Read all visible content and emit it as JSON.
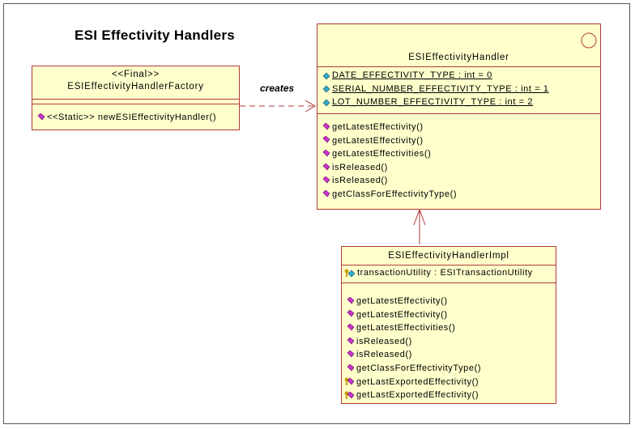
{
  "diagram": {
    "title": "ESI Effectivity Handlers",
    "factory": {
      "stereotype": "<<Final>>",
      "name": "ESIEffectivityHandlerFactory",
      "operations": [
        {
          "text": "<<Static>> newESIEffectivityHandler()",
          "icon": "public-operation-icon"
        }
      ]
    },
    "relation_label": "creates",
    "handler": {
      "name": "ESIEffectivityHandler",
      "attributes": [
        {
          "text": "DATE_EFFECTIVITY_TYPE : int = 0",
          "icon": "public-static-attribute-icon"
        },
        {
          "text": "SERIAL_NUMBER_EFFECTIVITY_TYPE : int = 1",
          "icon": "public-static-attribute-icon"
        },
        {
          "text": "LOT_NUMBER_EFFECTIVITY_TYPE : int = 2",
          "icon": "public-static-attribute-icon"
        }
      ],
      "operations": [
        {
          "text": "getLatestEffectivity()",
          "icon": "public-operation-icon"
        },
        {
          "text": "getLatestEffectivity()",
          "icon": "public-operation-icon"
        },
        {
          "text": "getLatestEffectivities()",
          "icon": "public-operation-icon"
        },
        {
          "text": "isReleased()",
          "icon": "public-operation-icon"
        },
        {
          "text": "isReleased()",
          "icon": "public-operation-icon"
        },
        {
          "text": "getClassForEffectivityType()",
          "icon": "public-operation-icon"
        }
      ]
    },
    "impl": {
      "name": "ESIEffectivityHandlerImpl",
      "attributes": [
        {
          "text": "transactionUtility : ESITransactionUtility",
          "icon": "private-attribute-icon"
        }
      ],
      "operations": [
        {
          "text": "getLatestEffectivity()",
          "icon": "public-operation-icon"
        },
        {
          "text": "getLatestEffectivity()",
          "icon": "public-operation-icon"
        },
        {
          "text": "getLatestEffectivities()",
          "icon": "public-operation-icon"
        },
        {
          "text": "isReleased()",
          "icon": "public-operation-icon"
        },
        {
          "text": "isReleased()",
          "icon": "public-operation-icon"
        },
        {
          "text": "getClassForEffectivityType()",
          "icon": "public-operation-icon"
        },
        {
          "text": "getLastExportedEffectivity()",
          "icon": "private-operation-icon"
        },
        {
          "text": "getLastExportedEffectivity()",
          "icon": "private-operation-icon"
        }
      ]
    },
    "colors": {
      "class_fill": "#ffffcc",
      "class_border": "#b33a3a",
      "operation_icon": "#cc33cc",
      "attribute_icon": "#33aacc",
      "key_icon": "#c8a000"
    }
  }
}
